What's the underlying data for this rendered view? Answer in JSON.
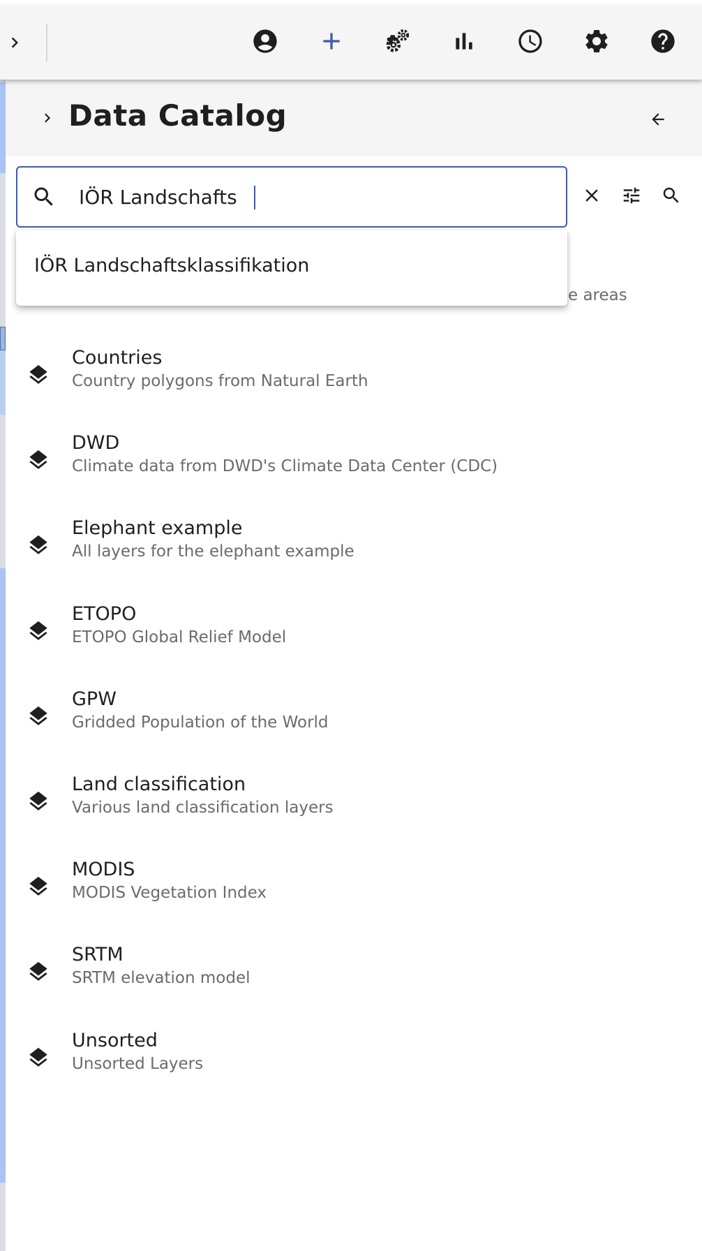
{
  "toolbar": {
    "icons": [
      "chevron-right-icon",
      "account-icon",
      "add-icon",
      "gears-icon",
      "bar-chart-icon",
      "clock-icon",
      "gear-icon",
      "help-icon"
    ],
    "accent_color": "#3f5aa8"
  },
  "panel": {
    "title": "Data Catalog"
  },
  "search": {
    "value": "IÖR Landschafts",
    "suggestion": "IÖR Landschaftsklassifikation",
    "partial_hidden_text": "e areas"
  },
  "catalog": {
    "items": [
      {
        "title": "Countries",
        "subtitle": "Country polygons from Natural Earth"
      },
      {
        "title": "DWD",
        "subtitle": "Climate data from DWD's Climate Data Center (CDC)"
      },
      {
        "title": "Elephant example",
        "subtitle": "All layers for the elephant example"
      },
      {
        "title": "ETOPO",
        "subtitle": "ETOPO Global Relief Model"
      },
      {
        "title": "GPW",
        "subtitle": "Gridded Population of the World"
      },
      {
        "title": "Land classification",
        "subtitle": "Various land classification layers"
      },
      {
        "title": "MODIS",
        "subtitle": "MODIS Vegetation Index"
      },
      {
        "title": "SRTM",
        "subtitle": "SRTM elevation model"
      },
      {
        "title": "Unsorted",
        "subtitle": "Unsorted Layers"
      }
    ]
  }
}
